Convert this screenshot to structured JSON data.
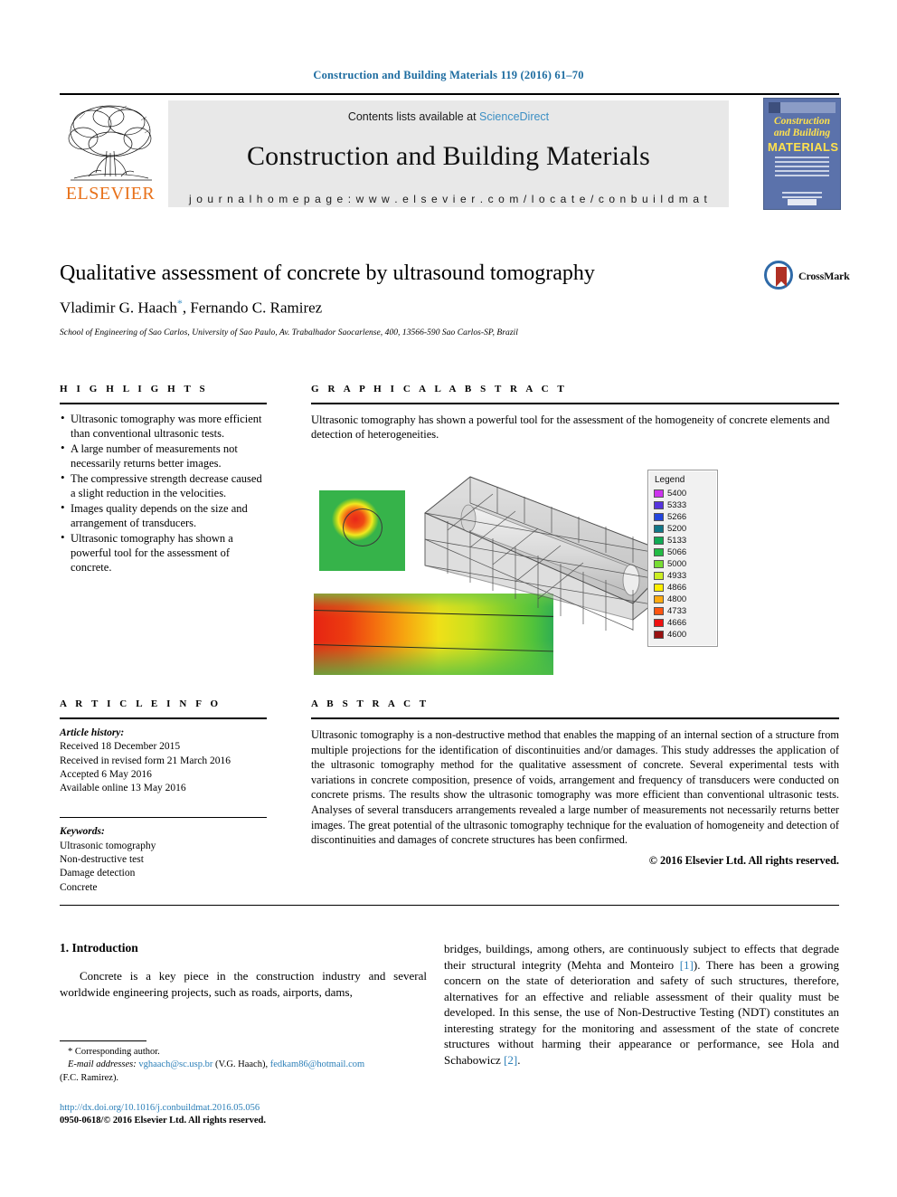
{
  "running_head": "Construction and Building Materials 119 (2016) 61–70",
  "masthead": {
    "contents_prefix": "Contents lists available at ",
    "sciencedirect": "ScienceDirect",
    "journal_title": "Construction and Building Materials",
    "homepage": "j o u r n a l   h o m e p a g e :   w w w . e l s e v i e r . c o m / l o c a t e / c o n b u i l d m a t",
    "publisher": "ELSEVIER",
    "cover": {
      "line1": "Construction",
      "line2": "and Building",
      "line3": "MATERIALS"
    }
  },
  "article": {
    "title": "Qualitative assessment of concrete by ultrasound tomography",
    "authors": "Vladimir G. Haach",
    "authors_rest": ", Fernando C. Ramirez",
    "corresponding_marker": "*",
    "affiliation": "School of Engineering of Sao Carlos, University of Sao Paulo, Av. Trabalhador Saocarlense, 400, 13566-590 Sao Carlos-SP, Brazil",
    "crossmark_label": "CrossMark"
  },
  "highlights": {
    "heading": "H I G H L I G H T S",
    "items": [
      "Ultrasonic tomography was more efficient than conventional ultrasonic tests.",
      "A large number of measurements not necessarily returns better images.",
      "The compressive strength decrease caused a slight reduction in the velocities.",
      "Images quality depends on the size and arrangement of transducers.",
      "Ultrasonic tomography has shown a powerful tool for the assessment of concrete."
    ]
  },
  "graphical_abstract": {
    "heading": "G R A P H I C A L   A B S T R A C T",
    "caption": "Ultrasonic tomography has shown a powerful tool for the assessment of the homogeneity of concrete elements and detection of heterogeneities.",
    "legend_title": "Legend",
    "legend": [
      {
        "value": "5400",
        "color": "#cc33ee"
      },
      {
        "value": "5333",
        "color": "#5533dd"
      },
      {
        "value": "5266",
        "color": "#2244dd"
      },
      {
        "value": "5200",
        "color": "#117788"
      },
      {
        "value": "5133",
        "color": "#11aa55"
      },
      {
        "value": "5066",
        "color": "#22bb44"
      },
      {
        "value": "5000",
        "color": "#77dd33"
      },
      {
        "value": "4933",
        "color": "#ccee22"
      },
      {
        "value": "4866",
        "color": "#ffee00"
      },
      {
        "value": "4800",
        "color": "#ffaa11"
      },
      {
        "value": "4733",
        "color": "#ff5511"
      },
      {
        "value": "4666",
        "color": "#ee1111"
      },
      {
        "value": "4600",
        "color": "#991111"
      }
    ]
  },
  "article_info": {
    "heading": "A R T I C L E   I N F O",
    "history_label": "Article history:",
    "history": [
      "Received 18 December 2015",
      "Received in revised form 21 March 2016",
      "Accepted 6 May 2016",
      "Available online 13 May 2016"
    ],
    "keywords_label": "Keywords:",
    "keywords": [
      "Ultrasonic tomography",
      "Non-destructive test",
      "Damage detection",
      "Concrete"
    ]
  },
  "abstract": {
    "heading": "A B S T R A C T",
    "text": "Ultrasonic tomography is a non-destructive method that enables the mapping of an internal section of a structure from multiple projections for the identification of discontinuities and/or damages. This study addresses the application of the ultrasonic tomography method for the qualitative assessment of concrete. Several experimental tests with variations in concrete composition, presence of voids, arrangement and frequency of transducers were conducted on concrete prisms. The results show the ultrasonic tomography was more efficient than conventional ultrasonic tests. Analyses of several transducers arrangements revealed a large number of measurements not necessarily returns better images. The great potential of the ultrasonic tomography technique for the evaluation of homogeneity and detection of discontinuities and damages of concrete structures has been confirmed.",
    "copyright": "© 2016 Elsevier Ltd. All rights reserved."
  },
  "introduction": {
    "heading": "1. Introduction",
    "left_paragraph": "Concrete is a key piece in the construction industry and several worldwide engineering projects, such as roads, airports, dams,",
    "right_paragraph_part1": "bridges, buildings, among others, are continuously subject to effects that degrade their structural integrity (Mehta and Monteiro ",
    "ref1": "[1]",
    "right_paragraph_part2": "). There has been a growing concern on the state of deterioration and safety of such structures, therefore, alternatives for an effective and reliable assessment of their quality must be developed. In this sense, the use of Non-Destructive Testing (NDT) constitutes an interesting strategy for the monitoring and assessment of the state of concrete structures without harming their appearance or performance, see Hola and Schabowicz ",
    "ref2": "[2]",
    "right_paragraph_end": "."
  },
  "footer": {
    "corresponding": "* Corresponding author.",
    "email_label": "E-mail addresses:",
    "email1": "vghaach@sc.usp.br",
    "email1_owner": " (V.G. Haach), ",
    "email2": "fedkam86@hotmail.com",
    "email2_owner": "(F.C. Ramirez).",
    "doi": "http://dx.doi.org/10.1016/j.conbuildmat.2016.05.056",
    "issn": "0950-0618/© 2016 Elsevier Ltd. All rights reserved."
  }
}
